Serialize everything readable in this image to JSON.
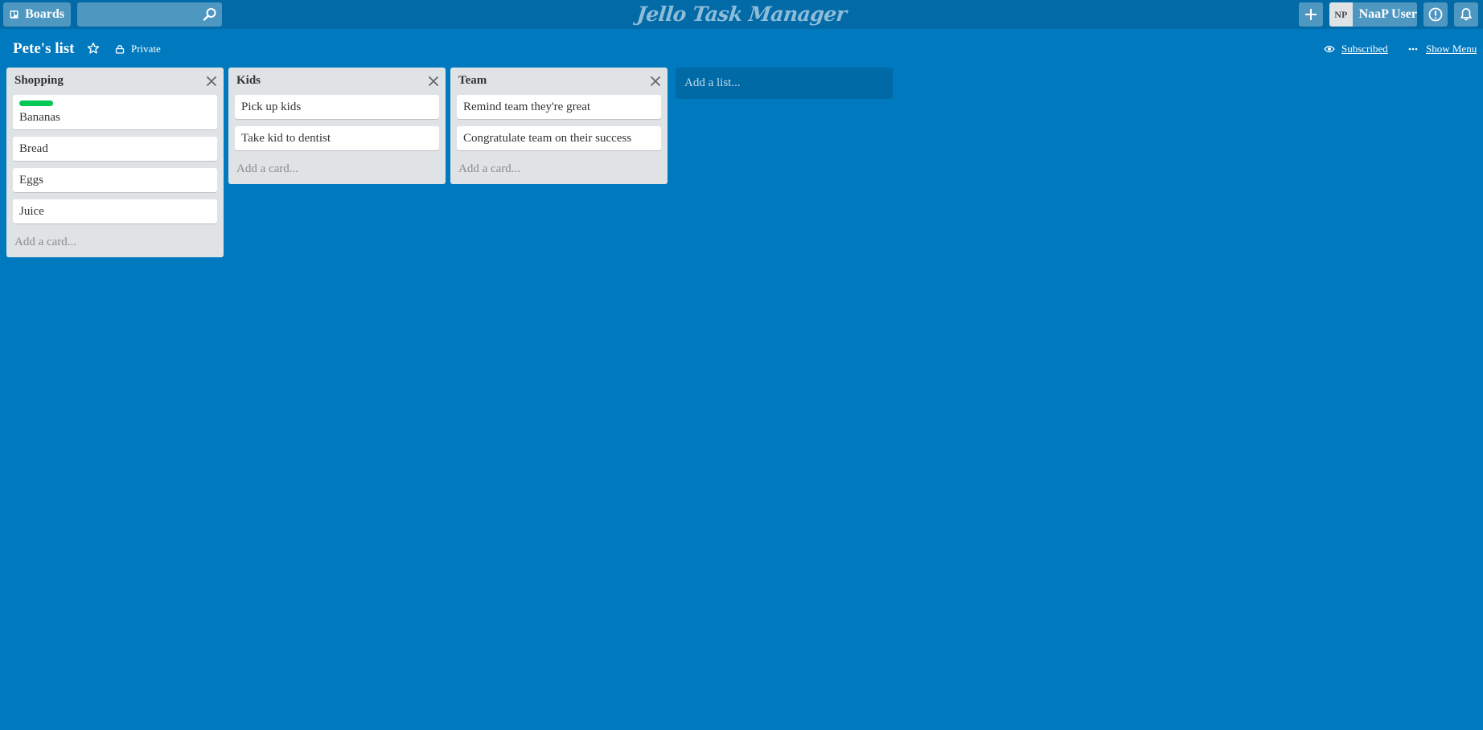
{
  "header": {
    "boards_label": "Boards",
    "search": {
      "value": "",
      "placeholder": ""
    },
    "app_title": "Jello Task Manager",
    "add_icon": "plus-icon",
    "user": {
      "initials": "NP",
      "name": "NaaP User"
    },
    "info_icon": "info-icon",
    "bell_icon": "bell-icon"
  },
  "board": {
    "title": "Pete's list",
    "visibility": "Private",
    "subscribed_label": "Subscribed",
    "menu_label": "Show Menu"
  },
  "lists": [
    {
      "title": "Shopping",
      "cards": [
        {
          "text": "Bananas",
          "label_color": "#00c853"
        },
        {
          "text": "Bread"
        },
        {
          "text": "Eggs"
        },
        {
          "text": "Juice"
        }
      ],
      "add_card": "Add a card..."
    },
    {
      "title": "Kids",
      "cards": [
        {
          "text": "Pick up kids"
        },
        {
          "text": "Take kid to dentist"
        }
      ],
      "add_card": "Add a card..."
    },
    {
      "title": "Team",
      "cards": [
        {
          "text": "Remind team they're great"
        },
        {
          "text": "Congratulate team on their success"
        }
      ],
      "add_card": "Add a card..."
    }
  ],
  "add_list": "Add a list...",
  "colors": {
    "background": "#0079bf",
    "header": "#026aa7",
    "list_bg": "#dfe3e6",
    "label_green": "#00c853"
  }
}
